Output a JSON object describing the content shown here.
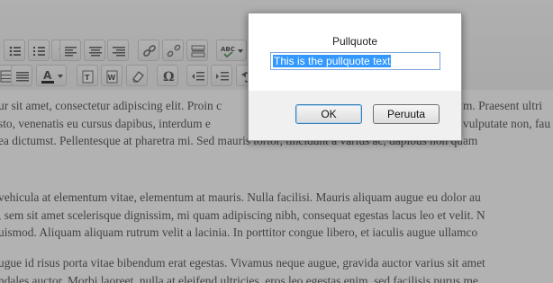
{
  "toolbar": {
    "row1": [
      {
        "name": "bulleted-list-icon",
        "glyph": "≡"
      },
      {
        "name": "numbered-list-icon",
        "glyph": "≡"
      },
      {
        "name": "blockquote-icon",
        "glyph": "❝"
      },
      {
        "name": "align-left-icon",
        "glyph": "≡"
      },
      {
        "name": "align-center-icon",
        "glyph": "≡"
      },
      {
        "name": "align-right-icon",
        "glyph": "≡"
      },
      {
        "name": "insert-link-icon",
        "glyph": "⚭"
      },
      {
        "name": "unlink-icon",
        "glyph": "⚮"
      },
      {
        "name": "insert-more-icon",
        "glyph": "▭"
      },
      {
        "name": "spellcheck-icon",
        "glyph": "ABC"
      }
    ],
    "row2": [
      {
        "name": "insert-table-icon",
        "glyph": "☰"
      },
      {
        "name": "justify-icon",
        "glyph": "≡"
      },
      {
        "name": "text-color-icon",
        "glyph": "A"
      },
      {
        "name": "paste-as-text-icon",
        "glyph": "T"
      },
      {
        "name": "paste-from-word-icon",
        "glyph": "W"
      },
      {
        "name": "remove-formatting-icon",
        "glyph": "⌫"
      },
      {
        "name": "special-character-icon",
        "glyph": "Ω"
      },
      {
        "name": "outdent-icon",
        "glyph": "⇤"
      },
      {
        "name": "indent-icon",
        "glyph": "⇥"
      },
      {
        "name": "undo-icon",
        "glyph": "↶"
      }
    ]
  },
  "editor": {
    "paragraphs": [
      [
        "ur sit amet, consectetur adipiscing elit. Proin c",
        "sto, venenatis eu cursus dapibus, interdum e",
        "ea dictumst. Pellentesque at pharetra mi. Sed mauris tortor, tincidunt a varius ac, dapibus non quam"
      ],
      [
        "vehicula at elementum vitae, elementum at mauris. Nulla facilisi. Mauris aliquam augue eu dolor au",
        ", sem sit amet scelerisque dignissim, mi quam adipiscing nibh, consequat egestas lacus leo et velit. N",
        "uismod. Aliquam aliquam rutrum velit a lacinia. In porttitor congue libero, et iaculis augue ullamco"
      ],
      [
        "ugue id risus porta vitae bibendum erat egestas. Vivamus neque augue, gravida auctor varius sit amet",
        "ndales auctor. Morbi laoreet, nulla at eleifend ultricies, eros leo egestas enim, sed facilisis purus me"
      ]
    ],
    "right_fragments": [
      "m. Praesent ultri",
      "vulputate non, fau"
    ]
  },
  "dialog": {
    "title": "Pullquote",
    "input_value": "This is the pullquote text",
    "ok_label": "OK",
    "cancel_label": "Peruuta"
  },
  "colors": {
    "overlay": "#555555",
    "selection": "#3399ff",
    "text_color_bar": "#000000"
  }
}
